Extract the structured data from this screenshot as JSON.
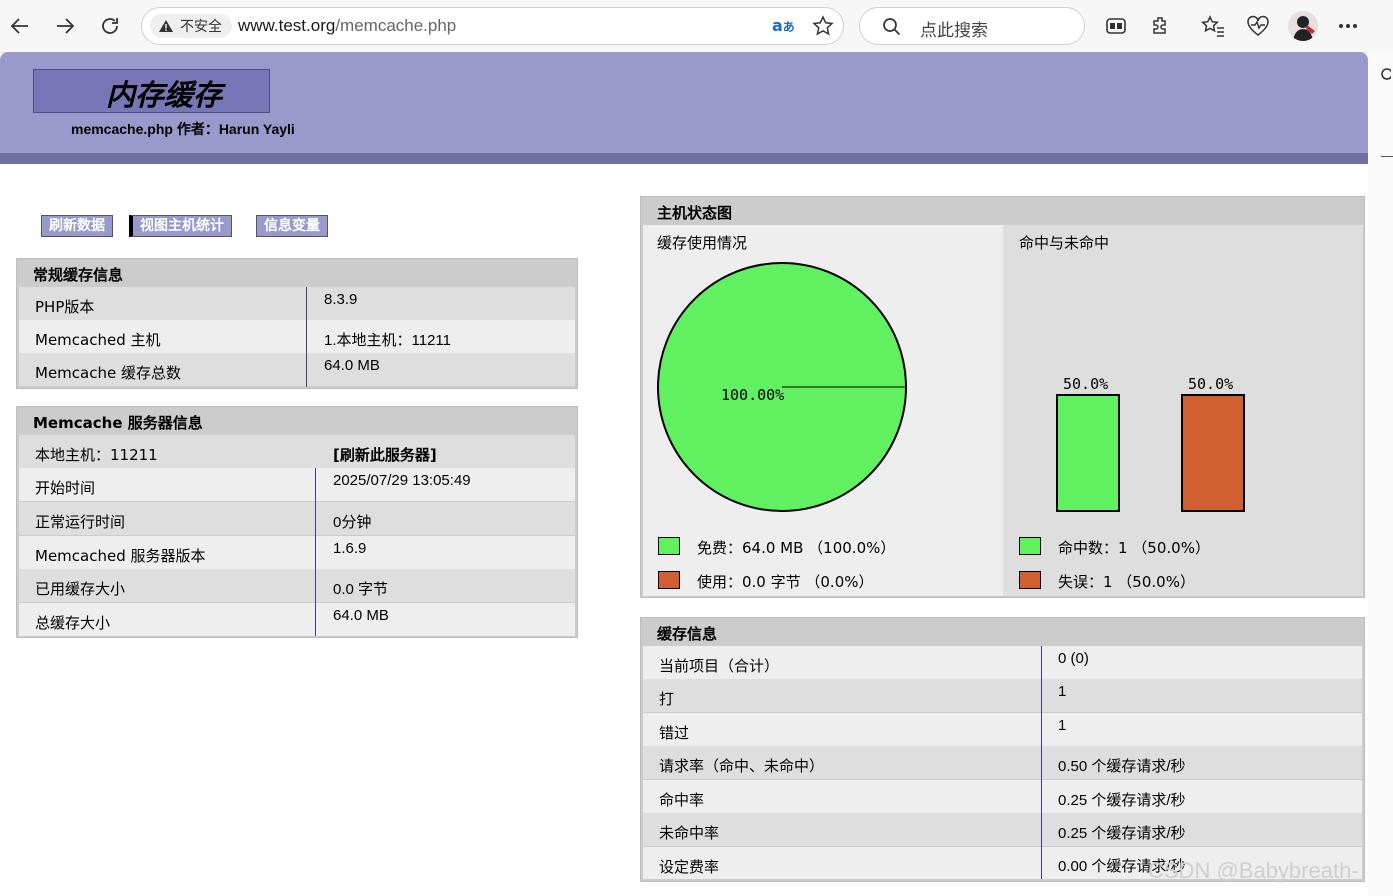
{
  "browser": {
    "security_label": "不安全",
    "url_host": "www.test.org",
    "url_path": "/memcache.php",
    "search_placeholder": "点此搜索"
  },
  "header": {
    "title": "内存缓存",
    "subtitle": "memcache.php 作者：Harun Yayli"
  },
  "menu": [
    "刷新数据",
    "视图主机统计",
    "信息变量"
  ],
  "general": {
    "title": "常规缓存信息",
    "rows": [
      {
        "label": "PHP版本",
        "value": "8.3.9"
      },
      {
        "label": "Memcached 主机",
        "value": "1.本地主机：11211"
      },
      {
        "label": "Memcache 缓存总数",
        "value": "64.0 MB"
      }
    ]
  },
  "server": {
    "title": "Memcache 服务器信息",
    "host": "本地主机：11211",
    "flush": "[刷新此服务器]",
    "rows": [
      {
        "label": "开始时间",
        "value": "2025/07/29 13:05:49"
      },
      {
        "label": "正常运行时间",
        "value": "0分钟"
      },
      {
        "label": "Memcached 服务器版本",
        "value": "1.6.9"
      },
      {
        "label": "已用缓存大小",
        "value": "0.0 字节"
      },
      {
        "label": "总缓存大小",
        "value": "64.0 MB"
      }
    ]
  },
  "graphs": {
    "title": "主机状态图",
    "usage_title": "缓存使用情况",
    "hits_title": "命中与未命中",
    "legend": {
      "free": "免费：64.0 MB （100.0%）",
      "used": "使用：0.0 字节 （0.0%）",
      "hits": "命中数：1 （50.0%）",
      "misses": "失误：1 （50.0%）"
    },
    "colors": {
      "green": "#60f060",
      "orange": "#d06030"
    }
  },
  "chart_data": [
    {
      "type": "pie",
      "categories": [
        "免费",
        "使用"
      ],
      "values": [
        100.0,
        0.0
      ],
      "data_labels": [
        "100.00%"
      ]
    },
    {
      "type": "bar",
      "categories": [
        "命中数",
        "失误"
      ],
      "values": [
        50.0,
        50.0
      ],
      "data_labels": [
        "50.0%",
        "50.0%"
      ],
      "ylim": [
        0,
        100
      ]
    }
  ],
  "cache": {
    "title": "缓存信息",
    "rows": [
      {
        "label": "当前项目（合计）",
        "value": "0 (0)"
      },
      {
        "label": "打",
        "value": "1"
      },
      {
        "label": "错过",
        "value": "1"
      },
      {
        "label": "请求率（命中、未命中）",
        "value": "0.50 个缓存请求/秒"
      },
      {
        "label": "命中率",
        "value": "0.25 个缓存请求/秒"
      },
      {
        "label": "未命中率",
        "value": "0.25 个缓存请求/秒"
      },
      {
        "label": "设定费率",
        "value": "0.00 个缓存请求/秒"
      }
    ]
  },
  "watermark": "CSDN @Babybreath-"
}
